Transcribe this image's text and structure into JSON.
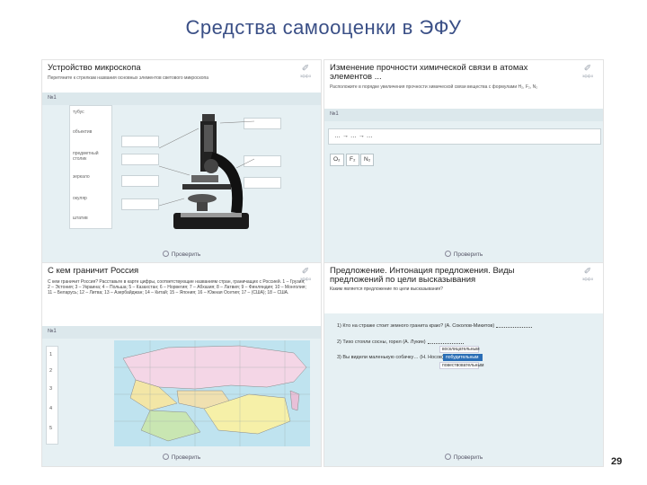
{
  "slide": {
    "title": "Средства самооценки в ЭФУ",
    "page_number": "29"
  },
  "logo": {
    "name": "эффо"
  },
  "check_label": "Проверить",
  "panel1": {
    "title": "Устройство микроскопа",
    "subtitle": "Перетяните к стрелкам названия основных элементов светового микроскопа",
    "task_num": "№1",
    "labels": [
      "тубус",
      "объектив",
      "предметный столик",
      "зеркало",
      "окуляр",
      "штатив"
    ]
  },
  "panel2": {
    "title": "Изменение прочности химической связи в атомах элементов ...",
    "subtitle": "Расположите в порядке увеличения прочности химической связи вещества с формулами H₂, F₂, N₂",
    "task_num": "№1",
    "formula": "… → … → …",
    "chips": [
      "O₂",
      "F₂",
      "N₂"
    ]
  },
  "panel3": {
    "title": "С кем граничит Россия",
    "subtitle": "С кем граничит Россия? Расставьте в карте цифры, соответствующие названиям стран, граничащих с Россией. 1 – Грузия; 2 – Эстония; 3 – Украина; 4 – Польша; 5 – Казахстан; 6 – Норвегия; 7 – Абхазия; 8 – Латвия; 9 – Финляндия; 10 – Монголия; 11 – Беларусь; 12 – Литва; 13 – Азербайджан; 14 – Китай; 15 – Япония; 16 – Южная Осетия; 17 – (США); 18 – США.",
    "task_num": "№1",
    "numbers": [
      "1",
      "2",
      "3",
      "4",
      "5"
    ]
  },
  "panel4": {
    "title": "Предложение. Интонация предложения. Виды предложений по цели высказывания",
    "subtitle": "Каким является предложение по цели высказывания?",
    "questions": [
      "1) Кто на страже стоит земного гранита краю? (А. Соколов-Микитов)",
      "2) Тихо стояли сосны, горел (А. Лукин)",
      "3) Вы видели маленькую собачку… (Н. Носов)"
    ],
    "options": [
      "восклицательным",
      "побудительным",
      "повествовательным"
    ]
  }
}
